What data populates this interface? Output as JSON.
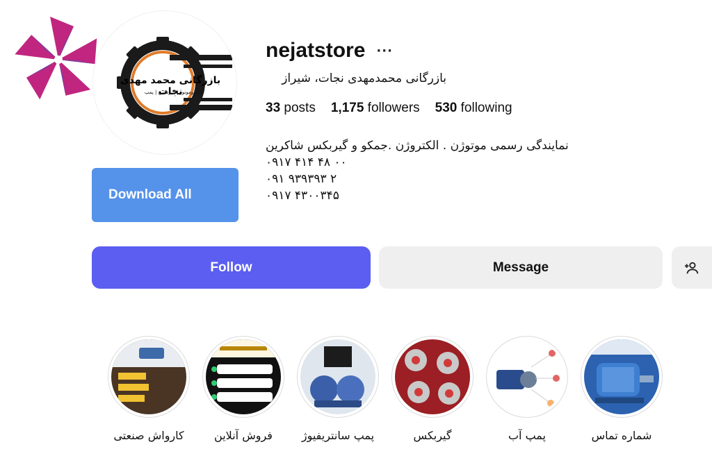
{
  "profile": {
    "username": "nejatstore",
    "more_label": "···",
    "full_name": "بازرگانی محمدمهدی نجات، شیراز",
    "logo_title": "بازرگانی محمد مهدی نجات",
    "logo_subtitle": "الکتروموتور | گیربکس | پمپ",
    "stats": {
      "posts_count": "33",
      "posts_label": "posts",
      "followers_count": "1,175",
      "followers_label": "followers",
      "following_count": "530",
      "following_label": "following"
    },
    "bio": [
      "نمایندگی رسمی موتوژن . الکتروژن .جمکو و گیربکس شاکرین",
      "۰۹۱۷ ۴۱۴ ۴۸ ۰۰",
      "۰۹۱ ۹۳۹۳۹۳ ۲",
      "۰۹۱۷ ۴۳۰۰۳۴۵"
    ]
  },
  "actions": {
    "download_all": "Download All",
    "follow": "Follow",
    "message": "Message",
    "suggest_icon": "add-person-icon"
  },
  "highlights": [
    {
      "label": "کارواش صنعتی",
      "thumb": "carwash"
    },
    {
      "label": "فروش آنلاین",
      "thumb": "online-sale"
    },
    {
      "label": "پمپ سانتریفیوژ",
      "thumb": "centrifugal-pump"
    },
    {
      "label": "گیربکس",
      "thumb": "gearbox"
    },
    {
      "label": "پمپ آب",
      "thumb": "water-pump"
    },
    {
      "label": "شماره تماس",
      "thumb": "motor"
    }
  ],
  "colors": {
    "follow_bg": "#5b5ef0",
    "download_bg": "#5592ea",
    "message_bg": "#efefef",
    "logo_orange": "#e07b2a"
  }
}
